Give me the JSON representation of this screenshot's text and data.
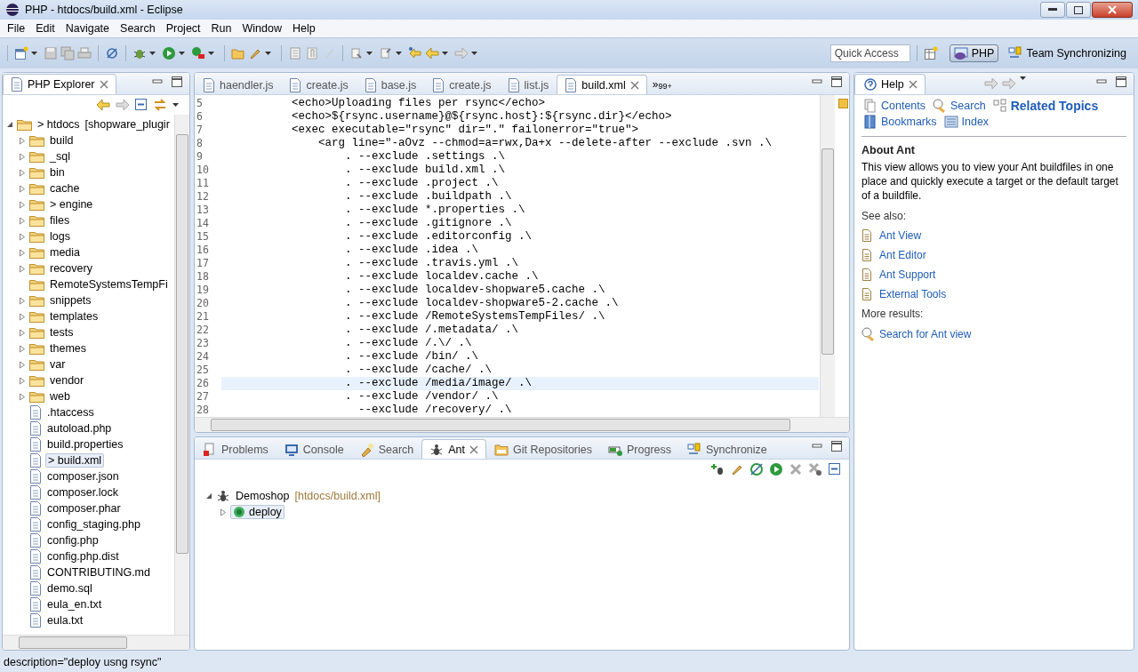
{
  "window": {
    "title": "PHP - htdocs/build.xml - Eclipse"
  },
  "menu": [
    "File",
    "Edit",
    "Navigate",
    "Search",
    "Project",
    "Run",
    "Window",
    "Help"
  ],
  "quick_access": {
    "placeholder": "Quick Access"
  },
  "perspectives": [
    {
      "label": "PHP",
      "selected": true
    },
    {
      "label": "Team Synchronizing",
      "selected": false
    }
  ],
  "explorer": {
    "title": "PHP Explorer",
    "root": {
      "label": "> htdocs",
      "suffix": "[shopware_plugir",
      "expanded": true
    },
    "items": [
      {
        "label": "build",
        "kind": "folder",
        "expandable": true,
        "selected": false
      },
      {
        "label": "_sql",
        "kind": "folder",
        "expandable": true,
        "selected": false
      },
      {
        "label": "bin",
        "kind": "folder",
        "expandable": true,
        "selected": false
      },
      {
        "label": "cache",
        "kind": "folder",
        "expandable": true,
        "selected": false
      },
      {
        "label": "> engine",
        "kind": "folder",
        "expandable": true,
        "selected": false
      },
      {
        "label": "files",
        "kind": "folder",
        "expandable": true,
        "selected": false
      },
      {
        "label": "logs",
        "kind": "folder",
        "expandable": true,
        "selected": false
      },
      {
        "label": "media",
        "kind": "folder",
        "expandable": true,
        "selected": false
      },
      {
        "label": "recovery",
        "kind": "folder",
        "expandable": true,
        "selected": false
      },
      {
        "label": "RemoteSystemsTempFi",
        "kind": "folder",
        "expandable": false,
        "selected": false
      },
      {
        "label": "snippets",
        "kind": "folder",
        "expandable": true,
        "selected": false
      },
      {
        "label": "templates",
        "kind": "folder",
        "expandable": true,
        "selected": false
      },
      {
        "label": "tests",
        "kind": "folder",
        "expandable": true,
        "selected": false
      },
      {
        "label": "themes",
        "kind": "folder",
        "expandable": true,
        "selected": false
      },
      {
        "label": "var",
        "kind": "folder",
        "expandable": true,
        "selected": false
      },
      {
        "label": "vendor",
        "kind": "folder",
        "expandable": true,
        "selected": false
      },
      {
        "label": "web",
        "kind": "folder",
        "expandable": true,
        "selected": false
      },
      {
        "label": ".htaccess",
        "kind": "file",
        "expandable": false,
        "selected": false
      },
      {
        "label": "autoload.php",
        "kind": "file",
        "expandable": false,
        "selected": false
      },
      {
        "label": "build.properties",
        "kind": "file",
        "expandable": false,
        "selected": false
      },
      {
        "label": "> build.xml",
        "kind": "file",
        "expandable": false,
        "selected": true
      },
      {
        "label": "composer.json",
        "kind": "file",
        "expandable": false,
        "selected": false
      },
      {
        "label": "composer.lock",
        "kind": "file",
        "expandable": false,
        "selected": false
      },
      {
        "label": "composer.phar",
        "kind": "file",
        "expandable": false,
        "selected": false
      },
      {
        "label": "config_staging.php",
        "kind": "file",
        "expandable": false,
        "selected": false
      },
      {
        "label": "config.php",
        "kind": "file",
        "expandable": false,
        "selected": false
      },
      {
        "label": "config.php.dist",
        "kind": "file",
        "expandable": false,
        "selected": false
      },
      {
        "label": "CONTRIBUTING.md",
        "kind": "file",
        "expandable": false,
        "selected": false
      },
      {
        "label": "demo.sql",
        "kind": "file",
        "expandable": false,
        "selected": false
      },
      {
        "label": "eula_en.txt",
        "kind": "file",
        "expandable": false,
        "selected": false
      },
      {
        "label": "eula.txt",
        "kind": "file",
        "expandable": false,
        "selected": false
      }
    ]
  },
  "editor": {
    "tabs": [
      {
        "label": "haendler.js",
        "selected": false
      },
      {
        "label": "create.js",
        "selected": false
      },
      {
        "label": "base.js",
        "selected": false
      },
      {
        "label": "create.js",
        "selected": false
      },
      {
        "label": "list.js",
        "selected": false
      },
      {
        "label": "build.xml",
        "selected": true
      }
    ],
    "overflow": "»",
    "overflow_count": "99+",
    "lines": [
      {
        "number": "5",
        "text": "          <echo>Uploading files per rsync</echo>",
        "current": false
      },
      {
        "number": "6",
        "text": "          <echo>${rsync.username}@${rsync.host}:${rsync.dir}</echo>",
        "current": false
      },
      {
        "number": "7",
        "text": "          <exec executable=\"rsync\" dir=\".\" failonerror=\"true\">",
        "current": false
      },
      {
        "number": "8",
        "text": "              <arg line=\"-aOvz --chmod=a=rwx,Da+x --delete-after --exclude .svn .\\",
        "current": false
      },
      {
        "number": "9",
        "text": "                  . --exclude .settings .\\",
        "current": false
      },
      {
        "number": "10",
        "text": "                  . --exclude build.xml .\\",
        "current": false
      },
      {
        "number": "11",
        "text": "                  . --exclude .project .\\",
        "current": false
      },
      {
        "number": "12",
        "text": "                  . --exclude .buildpath .\\",
        "current": false
      },
      {
        "number": "13",
        "text": "                  . --exclude *.properties .\\",
        "current": false
      },
      {
        "number": "14",
        "text": "                  . --exclude .gitignore .\\",
        "current": false
      },
      {
        "number": "15",
        "text": "                  . --exclude .editorconfig .\\",
        "current": false
      },
      {
        "number": "16",
        "text": "                  . --exclude .idea .\\",
        "current": false
      },
      {
        "number": "17",
        "text": "                  . --exclude .travis.yml .\\",
        "current": false
      },
      {
        "number": "18",
        "text": "                  . --exclude localdev.cache .\\",
        "current": false
      },
      {
        "number": "19",
        "text": "                  . --exclude localdev-shopware5.cache .\\",
        "current": false
      },
      {
        "number": "20",
        "text": "                  . --exclude localdev-shopware5-2.cache .\\",
        "current": false
      },
      {
        "number": "21",
        "text": "                  . --exclude /RemoteSystemsTempFiles/ .\\",
        "current": false
      },
      {
        "number": "22",
        "text": "                  . --exclude /.metadata/ .\\",
        "current": false
      },
      {
        "number": "23",
        "text": "                  . --exclude /.\\/ .\\",
        "current": false
      },
      {
        "number": "24",
        "text": "                  . --exclude /bin/ .\\",
        "current": false
      },
      {
        "number": "25",
        "text": "                  . --exclude /cache/ .\\",
        "current": false
      },
      {
        "number": "26",
        "text": "                  . --exclude /media/image/ .\\",
        "current": true
      },
      {
        "number": "27",
        "text": "                  . --exclude /vendor/ .\\",
        "current": false
      },
      {
        "number": "28",
        "text": "                    --exclude /recovery/ .\\",
        "current": false
      }
    ]
  },
  "bottom": {
    "tabs": [
      {
        "label": "Problems",
        "kind": "problems",
        "selected": false
      },
      {
        "label": "Console",
        "kind": "console",
        "selected": false
      },
      {
        "label": "Search",
        "kind": "search",
        "selected": false
      },
      {
        "label": "Ant",
        "kind": "ant",
        "selected": true
      },
      {
        "label": "Git Repositories",
        "kind": "git",
        "selected": false
      },
      {
        "label": "Progress",
        "kind": "progress",
        "selected": false
      },
      {
        "label": "Synchronize",
        "kind": "sync",
        "selected": false
      }
    ],
    "ant_tree": {
      "label": "Demoshop",
      "path": "[htdocs/build.xml]",
      "expanded": true,
      "children": [
        {
          "label": "deploy",
          "selected": true
        }
      ]
    }
  },
  "help": {
    "title": "Help",
    "nav": [
      {
        "label": "Contents",
        "selected": false
      },
      {
        "label": "Search",
        "selected": false
      },
      {
        "label": "Related Topics",
        "selected": true
      },
      {
        "label": "Bookmarks",
        "selected": false
      },
      {
        "label": "Index",
        "selected": false
      }
    ],
    "heading": "About Ant",
    "text": "This view allows you to view your Ant buildfiles in one place and quickly execute a target or the default target of a buildfile.",
    "see_also": "See also:",
    "links": [
      "Ant View",
      "Ant Editor",
      "Ant Support",
      "External Tools"
    ],
    "more_results": "More results:",
    "search_link": "Search for Ant view"
  },
  "status_bar": {
    "text": "description=\"deploy usng rsync\""
  }
}
